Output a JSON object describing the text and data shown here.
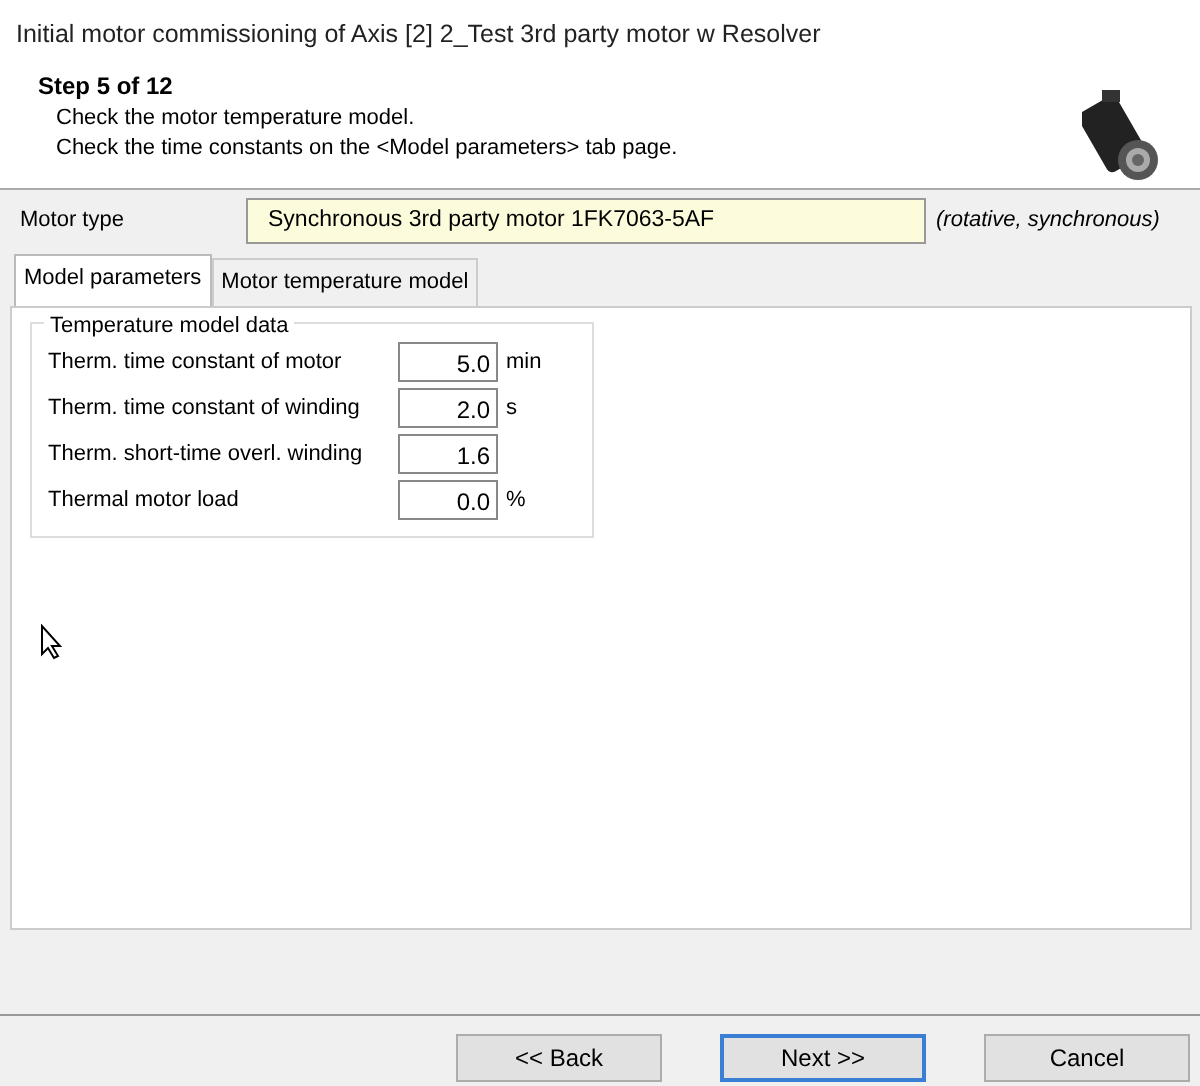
{
  "window": {
    "title": "Initial motor commissioning of Axis [2] 2_Test 3rd party motor w Resolver"
  },
  "header": {
    "step": "Step 5 of 12",
    "lines": [
      "Check the motor temperature model.",
      "Check the time constants on the <Model parameters> tab page."
    ]
  },
  "motor_type": {
    "label": "Motor type",
    "value": "Synchronous 3rd party motor 1FK7063-5AF",
    "note": "(rotative, synchronous)"
  },
  "tabs": [
    {
      "label": "Model parameters",
      "selected": true
    },
    {
      "label": "Motor temperature model",
      "selected": false
    }
  ],
  "group": {
    "title": "Temperature model data",
    "fields": [
      {
        "label": "Therm. time constant of motor",
        "value": "5.0",
        "unit": "min"
      },
      {
        "label": "Therm. time constant of winding",
        "value": "2.0",
        "unit": "s"
      },
      {
        "label": "Therm. short-time overl. winding",
        "value": "1.6"
      },
      {
        "label": "Thermal motor load",
        "value": "0.0",
        "unit": "%"
      }
    ]
  },
  "buttons": [
    {
      "label": "<< Back",
      "default": false
    },
    {
      "label": "Next >>",
      "default": true
    },
    {
      "label": "Cancel",
      "default": false
    }
  ]
}
